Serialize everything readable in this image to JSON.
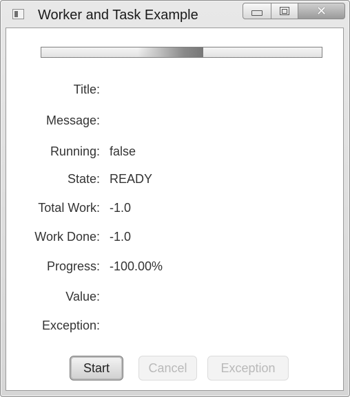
{
  "window": {
    "title": "Worker and Task Example",
    "controls": {
      "minimize_icon": "minimize-icon",
      "maximize_icon": "maximize-icon",
      "close_icon": "close-icon"
    }
  },
  "progress_bar": {
    "state": "indeterminate"
  },
  "fields": [
    {
      "label": "Title:",
      "value": ""
    },
    {
      "label": "Message:",
      "value": ""
    },
    {
      "label": "Running:",
      "value": "false"
    },
    {
      "label": "State:",
      "value": "READY"
    },
    {
      "label": "Total Work:",
      "value": "-1.0"
    },
    {
      "label": "Work Done:",
      "value": "-1.0"
    },
    {
      "label": "Progress:",
      "value": "-100.00%"
    },
    {
      "label": "Value:",
      "value": ""
    },
    {
      "label": "Exception:",
      "value": ""
    }
  ],
  "buttons": {
    "start": {
      "label": "Start",
      "enabled": true
    },
    "cancel": {
      "label": "Cancel",
      "enabled": false
    },
    "exception": {
      "label": "Exception",
      "enabled": false
    }
  },
  "colors": {
    "disabled_text": "#b9b9b9",
    "text": "#333333"
  }
}
